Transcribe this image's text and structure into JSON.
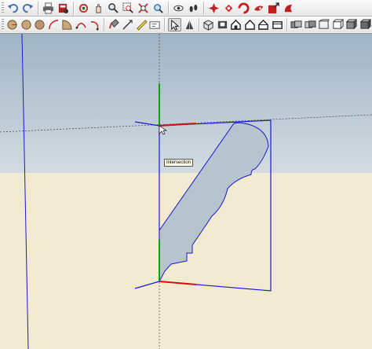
{
  "toolbar_top": {
    "tools": [
      {
        "name": "undo-icon",
        "color": "#3b6db3"
      },
      {
        "name": "redo-icon",
        "color": "#3b6db3"
      },
      {
        "name": "print-icon",
        "color": "#555555"
      },
      {
        "name": "model-info-icon",
        "color": "#b02020"
      },
      {
        "name": "orbit-icon",
        "color": "#c8302a"
      },
      {
        "name": "pan-icon",
        "color": "#2a6f2a"
      },
      {
        "name": "zoom-icon",
        "color": "#333333"
      },
      {
        "name": "zoom-window-icon",
        "color": "#333333"
      },
      {
        "name": "zoom-extents-icon",
        "color": "#c03030"
      },
      {
        "name": "previous-view-icon",
        "color": "#2a6fb0"
      },
      {
        "name": "position-camera-icon",
        "color": "#333333"
      },
      {
        "name": "walk-icon",
        "color": "#333333"
      },
      {
        "name": "look-around-icon",
        "color": "#c02020"
      },
      {
        "name": "section-plane-icon",
        "color": "#d02020"
      },
      {
        "name": "warehouse-icon",
        "color": "#c02020"
      },
      {
        "name": "extension-warehouse-icon",
        "color": "#c02020"
      },
      {
        "name": "share-model-icon",
        "color": "#c02020"
      }
    ]
  },
  "toolbar_bottom": {
    "tools": [
      "arc-icon",
      "pie-icon",
      "rotated-rectangle-icon",
      "polygon-icon",
      "circle-icon",
      "arc-2pt-icon",
      "arc-3pt-icon",
      "paint-bucket-icon",
      "tape-measure-icon",
      "protractor-icon",
      "text-icon",
      "select-icon",
      "section-display-icon",
      "iso-view-icon",
      "top-view-icon",
      "front-view-icon",
      "right-view-icon",
      "back-view-icon",
      "left-view-icon",
      "xray-icon",
      "back-edges-icon",
      "wireframe-icon",
      "hidden-line-icon",
      "shaded-icon",
      "textured-icon"
    ],
    "active_tool": "select-icon"
  },
  "viewport": {
    "sky_color": "#c6d1da",
    "ground_color": "#f3ead2",
    "profile_fill": "#b6c4d0",
    "axis_colors": {
      "red": "#d01010",
      "green": "#10a010",
      "blue": "#1a1acd"
    }
  },
  "tooltip": {
    "text": "Intersection"
  }
}
